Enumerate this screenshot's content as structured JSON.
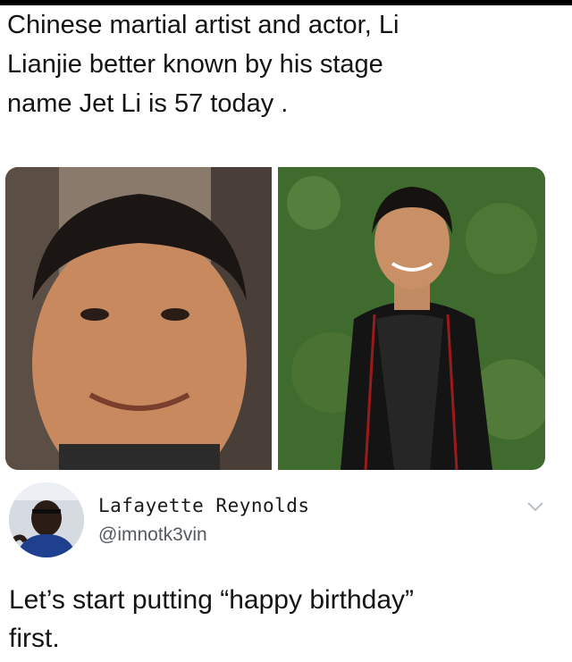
{
  "headline": {
    "lines": [
      "Chinese martial artist and actor, Li",
      "Lianjie better known by his stage",
      "name Jet Li is 57 today ."
    ]
  },
  "photos": {
    "left": {
      "icon": "portrait-closeup-photo"
    },
    "right": {
      "icon": "portrait-standing-photo"
    }
  },
  "tweet": {
    "display_name": "Lafayette Reynolds",
    "handle": "@imnotk3vin",
    "text_lines": [
      "Let’s start putting “happy birthday”",
      "first."
    ],
    "menu_icon": "chevron-down-icon"
  },
  "colors": {
    "background": "#ffffff",
    "text": "#141414",
    "handle": "#555a60",
    "chevron": "#b8bfc6"
  }
}
